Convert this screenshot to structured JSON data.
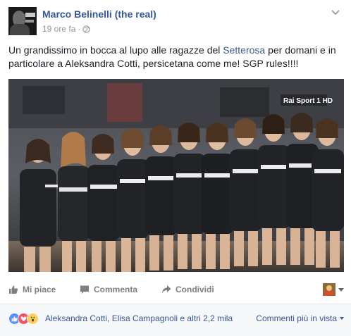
{
  "post": {
    "author": "Marco Belinelli (the real)",
    "time": "19 ore fa",
    "separator": "·",
    "icons": {
      "privacy": "globe-icon",
      "options": "chevron-down-icon"
    },
    "text_before": "Un grandissimo in bocca al lupo alle ragazze del ",
    "text_link": "Setterosa",
    "text_after": " per domani e in particolare a Aleksandra Cotti, persicetana come me! SGP rules!!!!",
    "photo": {
      "broadcaster_logo": "Rai Sport 1 HD"
    }
  },
  "actions": {
    "like": "Mi piace",
    "comment": "Commenta",
    "share": "Condividi",
    "icons": [
      "thumbs-up-icon",
      "comment-icon",
      "share-icon"
    ]
  },
  "reactions": {
    "summary": "Aleksandra Cotti, Elisa Campagnoli e altri 2,2 mila",
    "sort": "Commenti più in vista",
    "icons": [
      "like-reaction-icon",
      "love-reaction-icon",
      "wow-reaction-icon"
    ]
  },
  "colors": {
    "link": "#365899",
    "meta": "#90949c",
    "action": "#7f7f7f",
    "footer_bg": "#f6f7f9"
  }
}
